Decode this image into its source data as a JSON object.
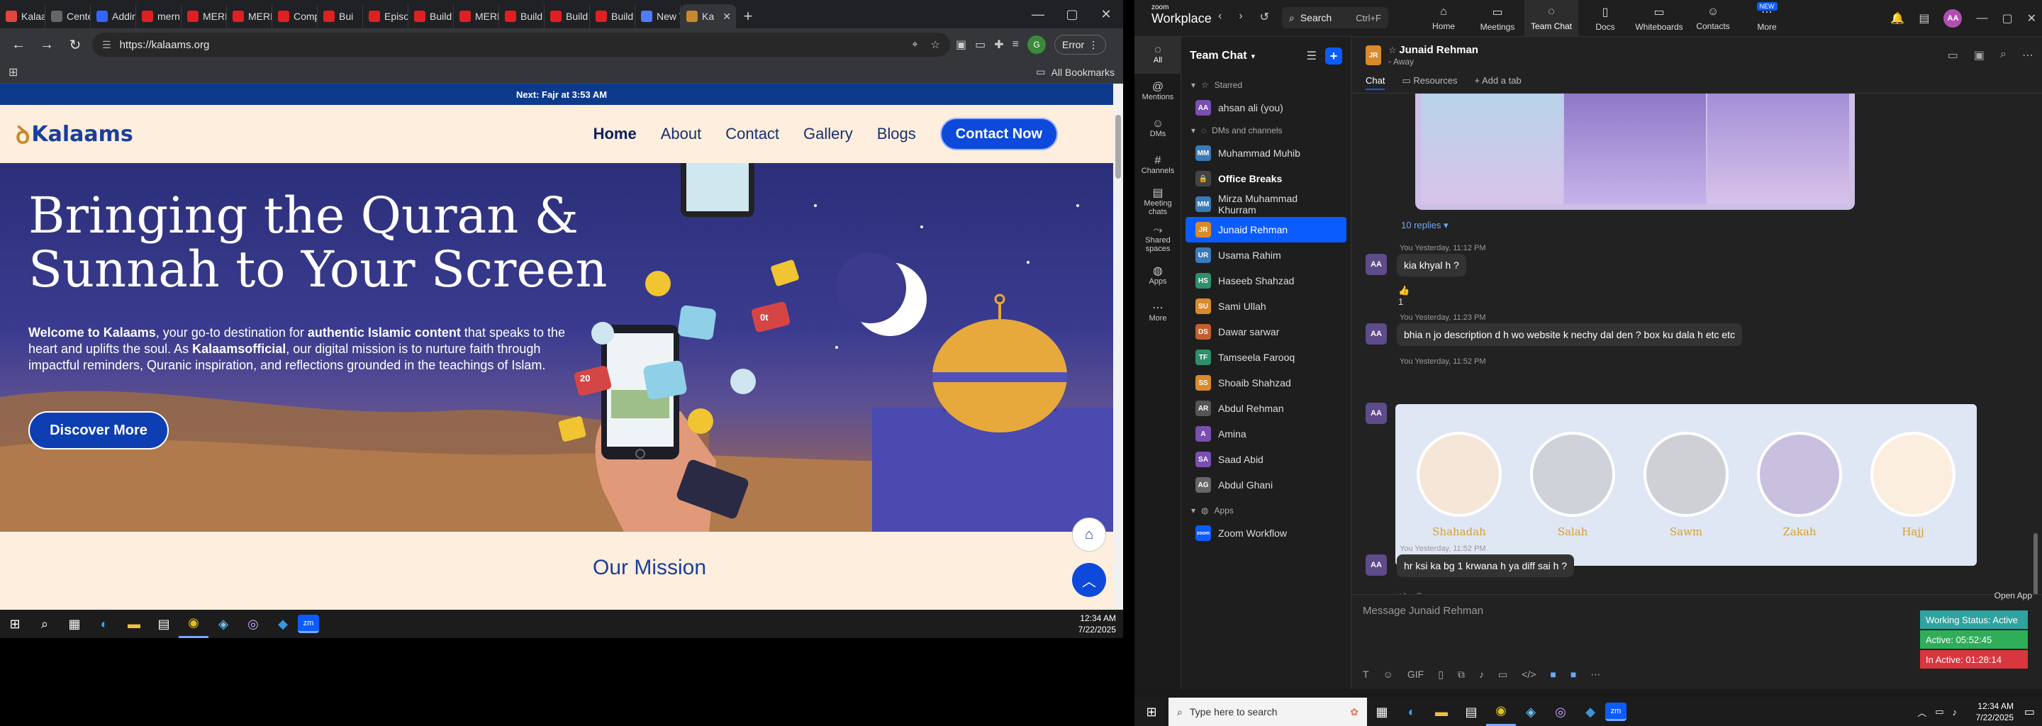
{
  "browser": {
    "tabs": [
      {
        "label": "Kalaan",
        "color": "#e2453c"
      },
      {
        "label": "Center",
        "color": "#666666"
      },
      {
        "label": "Adding",
        "color": "#3366ff"
      },
      {
        "label": "mern",
        "color": "#e02020"
      },
      {
        "label": "MERN",
        "color": "#e02020"
      },
      {
        "label": "MERN",
        "color": "#e02020"
      },
      {
        "label": "Compl",
        "color": "#e02020"
      },
      {
        "label": "Bui",
        "color": "#e02020"
      },
      {
        "label": "Episod",
        "color": "#e02020"
      },
      {
        "label": "Build",
        "color": "#e02020"
      },
      {
        "label": "MERN",
        "color": "#e02020"
      },
      {
        "label": "Build",
        "color": "#e02020"
      },
      {
        "label": "Build",
        "color": "#e02020"
      },
      {
        "label": "Build",
        "color": "#e02020"
      },
      {
        "label": "New T",
        "color": "#4d7cff"
      },
      {
        "label": "Ka",
        "color": "#c8882b"
      }
    ],
    "url": "https://kalaams.org",
    "error_label": "Error",
    "bookmarks_label": "All Bookmarks",
    "profile_initial": "G"
  },
  "site": {
    "prayer_banner": "Next: Fajr at 3:53 AM",
    "logo_text": "Kalaams",
    "nav": [
      "Home",
      "About",
      "Contact",
      "Gallery",
      "Blogs"
    ],
    "cta_label": "Contact Now",
    "hero_title": "Bringing the Quran & Sunnah to Your Screen",
    "hero_body": {
      "p1": "Welcome to Kalaams",
      "p2": ", your go-to destination for ",
      "p3": "authentic Islamic content",
      "p4": " that speaks to the heart and uplifts the soul. As ",
      "p5": "Kalaamsofficial",
      "p6": ", our digital mission is to nurture faith through impactful reminders, Quranic inspiration, and reflections grounded in the teachings of Islam."
    },
    "hero_button": "Discover More",
    "mission_title": "Our Mission",
    "social_badges": [
      "20",
      "0t"
    ]
  },
  "taskbar_left": {
    "time": "12:34 AM",
    "date": "7/22/2025"
  },
  "zoom": {
    "brand_small": "zoom",
    "brand": "Workplace",
    "search_label": "Search",
    "search_shortcut": "Ctrl+F",
    "main_nav": [
      {
        "label": "Home",
        "icon": "home-icon"
      },
      {
        "label": "Meetings",
        "icon": "meetings-icon"
      },
      {
        "label": "Team Chat",
        "icon": "chat-icon"
      },
      {
        "label": "Docs",
        "icon": "docs-icon"
      },
      {
        "label": "Whiteboards",
        "icon": "whiteboard-icon"
      },
      {
        "label": "Contacts",
        "icon": "contacts-icon"
      },
      {
        "label": "More",
        "icon": "more-icon"
      }
    ],
    "new_badge": "NEW",
    "user_initials": "AA",
    "rail": [
      {
        "label": "All",
        "icon": "chat-bubble-icon"
      },
      {
        "label": "Mentions",
        "icon": "at-icon"
      },
      {
        "label": "DMs",
        "icon": "people-icon"
      },
      {
        "label": "Channels",
        "icon": "hash-icon"
      },
      {
        "label": "Meeting chats",
        "icon": "calendar-icon"
      },
      {
        "label": "Shared spaces",
        "icon": "share-icon"
      },
      {
        "label": "Apps",
        "icon": "apps-icon"
      },
      {
        "label": "More",
        "icon": "dots-icon"
      }
    ],
    "list_title": "Team Chat",
    "sections": {
      "starred": "Starred",
      "dms": "DMs and channels",
      "apps": "Apps"
    },
    "starred": [
      {
        "name": "ahsan ali (you)",
        "initials": "AA",
        "color": "#7a4fb0"
      }
    ],
    "contacts": [
      {
        "name": "Muhammad Muhib",
        "initials": "MM",
        "color": "#3a7ab8"
      },
      {
        "name": "Office Breaks",
        "initials": "",
        "color": "#444444",
        "bold": true
      },
      {
        "name": "Mirza Muhammad Khurram",
        "initials": "MM",
        "color": "#3a7ab8"
      },
      {
        "name": "Junaid Rehman",
        "initials": "JR",
        "color": "#d98a2b",
        "active": true
      },
      {
        "name": "Usama Rahim",
        "initials": "UR",
        "color": "#3a7ab8"
      },
      {
        "name": "Haseeb Shahzad",
        "initials": "HS",
        "color": "#2f8f6a"
      },
      {
        "name": "Sami Ullah",
        "initials": "SU",
        "color": "#d98a2b"
      },
      {
        "name": "Dawar sarwar",
        "initials": "DS",
        "color": "#c06030"
      },
      {
        "name": "Tamseela Farooq",
        "initials": "TF",
        "color": "#2f8f6a"
      },
      {
        "name": "Shoaib Shahzad",
        "initials": "SS",
        "color": "#d98a2b"
      },
      {
        "name": "Abdul Rehman",
        "initials": "AR",
        "color": "#555555"
      },
      {
        "name": "Amina",
        "initials": "A",
        "color": "#7a4fb0"
      },
      {
        "name": "Saad Abid",
        "initials": "SA",
        "color": "#7a4fb0"
      },
      {
        "name": "Abdul Ghani",
        "initials": "AG",
        "color": "#666666"
      }
    ],
    "apps": [
      {
        "name": "Zoom Workflow",
        "initials": "zoom",
        "color": "#0b5cff"
      }
    ],
    "chat_name": "Junaid Rehman",
    "chat_initials": "JR",
    "chat_status": "Away",
    "chat_tabs": [
      "Chat",
      "Resources",
      "Add a tab"
    ],
    "replies": "10 replies",
    "messages": [
      {
        "meta": "You Yesterday, 11:12 PM",
        "text": "kia khyal h ?",
        "reaction": "👍 1"
      },
      {
        "meta": "You Yesterday, 11:23 PM",
        "text": "bhia n jo description d h wo website k nechy dal den ? box ku dala h etc etc"
      },
      {
        "meta": "You Yesterday, 11:52 PM",
        "pillars": [
          "Shahadah",
          "Salah",
          "Sawm",
          "Zakah",
          "Hajj"
        ]
      },
      {
        "meta": "You Yesterday, 11:52 PM",
        "text": "hr ksi ka bg 1 krwana h ya diff sai h ?"
      }
    ],
    "compose_placeholder": "Message Junaid Rehman",
    "open_app": "Open App",
    "working_status": "Working Status: Active",
    "active_time": "Active: 05:52:45",
    "inactive_time": "In Active: 01:28:14",
    "colors": {
      "working": "#2fa3a0",
      "active": "#2fae5a",
      "inactive": "#d9363e"
    }
  },
  "taskbar_right": {
    "search_placeholder": "Type here to search",
    "time": "12:34 AM",
    "date": "7/22/2025"
  }
}
